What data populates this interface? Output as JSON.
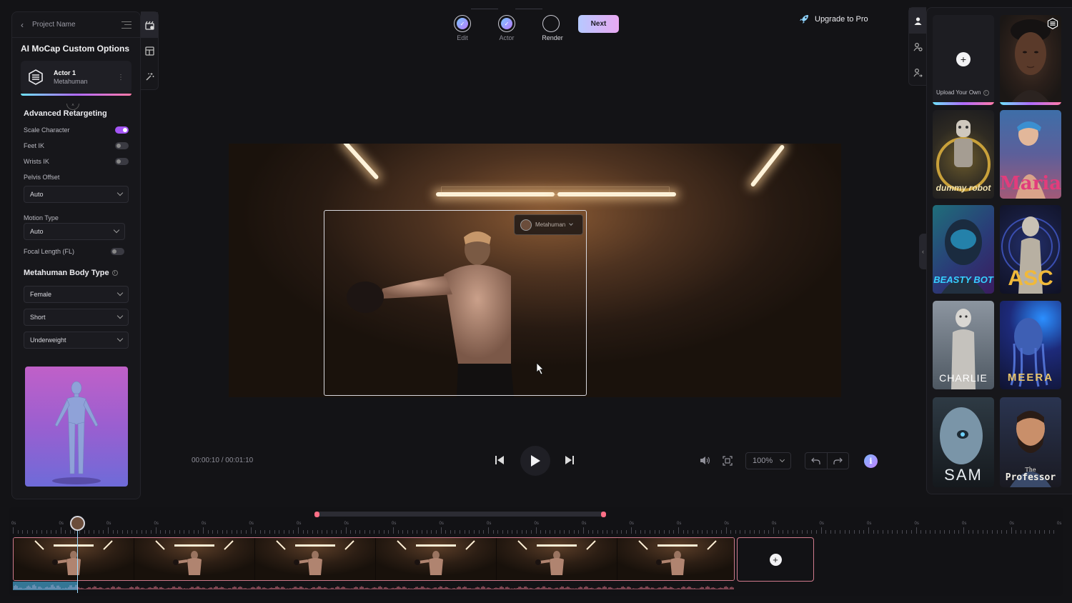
{
  "sidebar": {
    "project_name": "Project Name",
    "title": "AI MoCap Custom Options",
    "actor": {
      "name": "Actor 1",
      "type": "Metahuman"
    },
    "advanced_heading": "Advanced Retargeting",
    "toggles": [
      {
        "label": "Scale Character",
        "on": true
      },
      {
        "label": "Feet IK",
        "on": false
      },
      {
        "label": "Wrists IK",
        "on": false
      }
    ],
    "pelvis_offset": {
      "label": "Pelvis Offset",
      "value": "Auto"
    },
    "motion_type": {
      "label": "Motion Type",
      "value": "Auto"
    },
    "focal_length": {
      "label": "Focal Length (FL)",
      "on": false
    },
    "body_type_heading": "Metahuman Body Type",
    "body_gender": "Female",
    "body_height": "Short",
    "body_weight": "Underweight"
  },
  "stepper": {
    "steps": [
      {
        "label": "Edit",
        "done": true
      },
      {
        "label": "Actor",
        "done": true
      },
      {
        "label": "Render",
        "done": false
      }
    ],
    "next_label": "Next"
  },
  "header": {
    "upgrade_label": "Upgrade to Pro"
  },
  "viewer": {
    "actor_select_label": "Metahuman"
  },
  "playback": {
    "current_time": "00:00:10",
    "separator": "/",
    "total_time": "00:01:10",
    "zoom": "100%"
  },
  "avatars": {
    "upload_label": "Upload Your Own",
    "cards": [
      {
        "name": "dummy robot",
        "label": "dummy robot"
      },
      {
        "name": "Maria",
        "label": "Maria"
      },
      {
        "name": "Beasty Bot",
        "label": "BEASTY BOT"
      },
      {
        "name": "ASC",
        "label": "ASC"
      },
      {
        "name": "Charlie",
        "label": "CHARLIE"
      },
      {
        "name": "Meera",
        "label": "MEERA"
      },
      {
        "name": "Sam",
        "label": "SAM"
      },
      {
        "name": "The Professor",
        "label_small": "The",
        "label": "Professor"
      }
    ]
  },
  "timeline": {
    "tick_label": "0s"
  },
  "colors": {
    "accent_purple": "#a455f5",
    "clip_border": "#d07a8c",
    "range_knob": "#ff6f86",
    "playhead": "#9edcff"
  }
}
